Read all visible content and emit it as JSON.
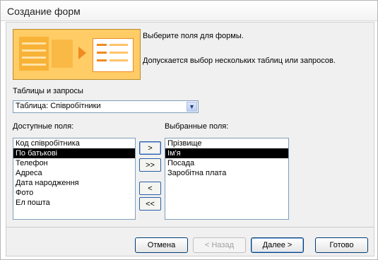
{
  "window": {
    "title": "Создание форм"
  },
  "intro": {
    "line1": "Выберите поля для формы.",
    "line2": "Допускается выбор нескольких таблиц или запросов."
  },
  "tables": {
    "label": "Таблицы и запросы",
    "selected": "Таблица: Співробітники"
  },
  "available": {
    "label": "Доступные поля:",
    "items": [
      "Код співробітника",
      "По батькові",
      "Телефон",
      "Адреса",
      "Дата народження",
      "Фото",
      "Ел пошта"
    ],
    "selected_index": 1
  },
  "chosen": {
    "label": "Выбранные поля:",
    "items": [
      "Прізвище",
      "Ім'я",
      "Посада",
      "Заробітна плата"
    ],
    "selected_index": 1
  },
  "move_buttons": {
    "add_one": ">",
    "add_all": ">>",
    "remove_one": "<",
    "remove_all": "<<"
  },
  "buttons": {
    "cancel": "Отмена",
    "back": "< Назад",
    "next": "Далее >",
    "finish": "Готово"
  },
  "colors": {
    "accent_border": "#003c74",
    "selection": "#000000",
    "wizard_art": "#f08b1f"
  }
}
